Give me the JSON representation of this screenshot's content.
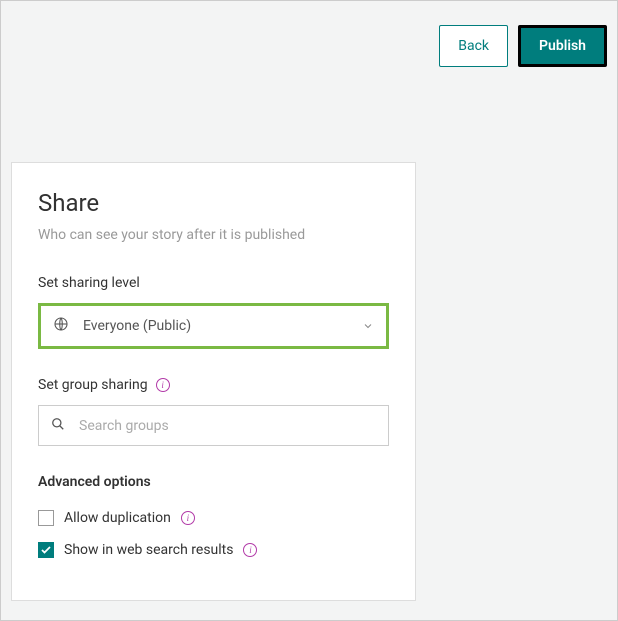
{
  "topbar": {
    "back_label": "Back",
    "publish_label": "Publish"
  },
  "panel": {
    "title": "Share",
    "subtitle": "Who can see your story after it is published"
  },
  "sharing": {
    "label": "Set sharing level",
    "selected": "Everyone (Public)"
  },
  "groups": {
    "label": "Set group sharing",
    "placeholder": "Search groups"
  },
  "advanced": {
    "title": "Advanced options",
    "allow_duplication_label": "Allow duplication",
    "allow_duplication_checked": false,
    "show_in_search_label": "Show in web search results",
    "show_in_search_checked": true
  }
}
